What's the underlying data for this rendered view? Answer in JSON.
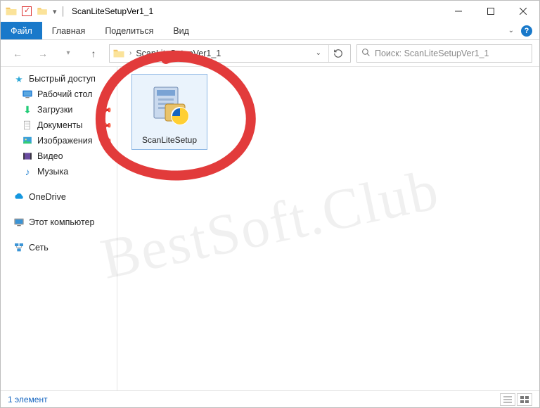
{
  "titlebar": {
    "title": "ScanLiteSetupVer1_1"
  },
  "ribbon": {
    "file": "Файл",
    "tabs": [
      "Главная",
      "Поделиться",
      "Вид"
    ]
  },
  "address": {
    "path": "ScanLiteSetupVer1_1"
  },
  "search": {
    "placeholder": "Поиск: ScanLiteSetupVer1_1"
  },
  "sidebar": {
    "quick_access": "Быстрый доступ",
    "items": [
      {
        "label": "Рабочий стол",
        "pin": true
      },
      {
        "label": "Загрузки",
        "pin": true
      },
      {
        "label": "Документы",
        "pin": true
      },
      {
        "label": "Изображения",
        "pin": true
      },
      {
        "label": "Видео",
        "pin": false
      },
      {
        "label": "Музыка",
        "pin": false
      }
    ],
    "onedrive": "OneDrive",
    "this_pc": "Этот компьютер",
    "network": "Сеть"
  },
  "content": {
    "file_name": "ScanLiteSetup"
  },
  "status": {
    "count_label": "1 элемент"
  },
  "watermark": "BestSoft.Club"
}
